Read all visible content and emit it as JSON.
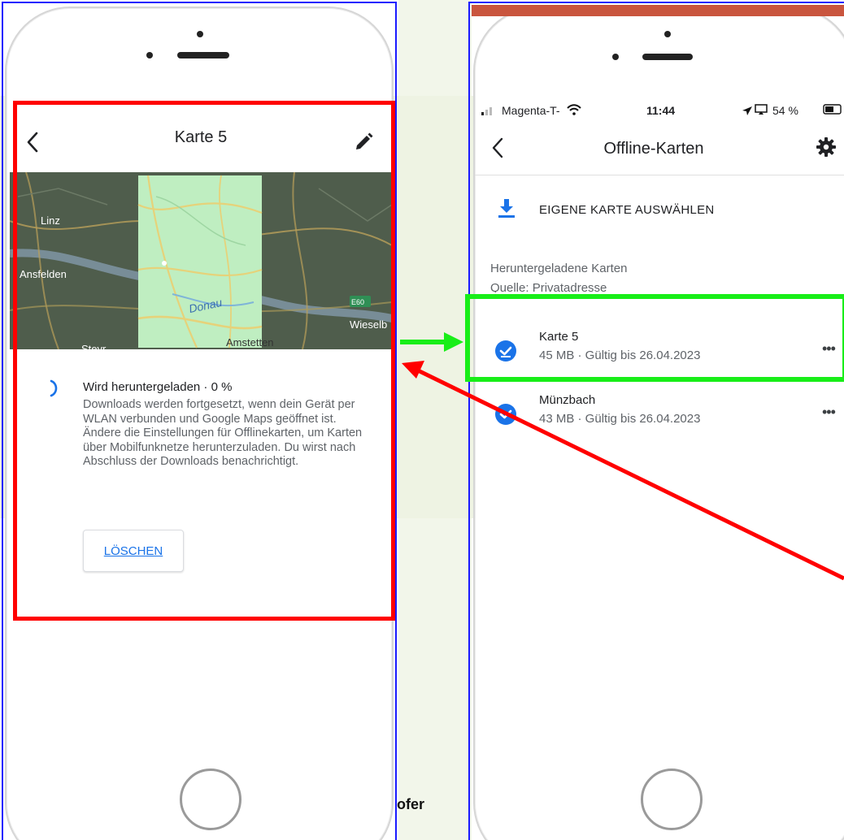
{
  "left_phone": {
    "header": {
      "title": "Karte 5"
    },
    "map": {
      "places": [
        "Linz",
        "Ansfelden",
        "Donau",
        "E60",
        "Amstetten",
        "Wieselb",
        "Steyr"
      ]
    },
    "download": {
      "title": "Wird heruntergeladen · 0 %",
      "description": "Downloads werden fortgesetzt, wenn dein Gerät per WLAN verbunden und Google Maps geöffnet ist. Ändere die Einstellungen für Offlinekarten, um Karten über Mobilfunknetze herunterzuladen. Du wirst nach Abschluss der Downloads benachrichtigt.",
      "progress_percent": 0
    },
    "delete_button": {
      "label": "LÖSCHEN"
    }
  },
  "footer_text": "ofer",
  "right_phone": {
    "status_bar": {
      "carrier": "Magenta-T-",
      "time": "11:44",
      "battery": "54 %"
    },
    "header": {
      "title": "Offline-Karten"
    },
    "select_own_map": {
      "label": "EIGENE KARTE AUSWÄHLEN"
    },
    "section": {
      "title": "Heruntergeladene Karten",
      "subtitle": "Quelle: Privatadresse"
    },
    "maps": [
      {
        "name": "Karte 5",
        "meta": "45 MB · Gültig bis 26.04.2023",
        "more": "•••"
      },
      {
        "name": "Münzbach",
        "meta": "43 MB · Gültig bis 26.04.2023",
        "more": "•••"
      }
    ]
  },
  "colors": {
    "accent_blue": "#1a73e8",
    "highlight_red": "#ff0000",
    "highlight_green": "#18ee18",
    "frame_blue": "#1a1aff"
  }
}
